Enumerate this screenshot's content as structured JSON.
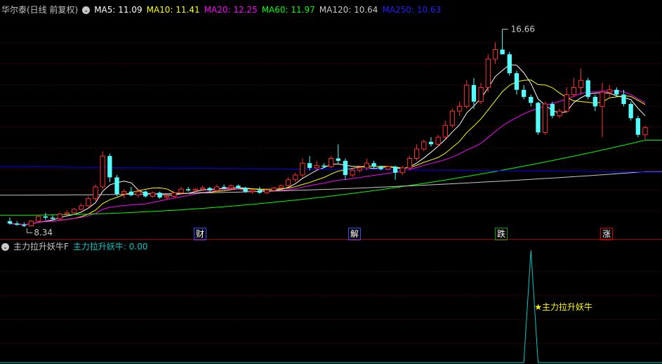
{
  "main_legend": {
    "title": "华尔泰(日线 前复权)",
    "items": [
      {
        "label": "MA5: 11.09",
        "color": "#ffffff"
      },
      {
        "label": "MA10: 11.41",
        "color": "#ffff00"
      },
      {
        "label": "MA20: 12.25",
        "color": "#ff00ff"
      },
      {
        "label": "MA60: 11.97",
        "color": "#00ff00"
      },
      {
        "label": "MA120: 10.64",
        "color": "#c8c8c8"
      },
      {
        "label": "MA250: 10.63",
        "color": "#0000ff"
      }
    ]
  },
  "sub_legend": {
    "title": "主力拉升妖牛F",
    "value_label": "主力拉升妖牛: 0.00",
    "value_color": "#00c8c8"
  },
  "markers": [
    {
      "label": "财",
      "color": "#3050ff"
    },
    {
      "label": "解",
      "color": "#3050ff"
    },
    {
      "label": "跌",
      "color": "#00a000"
    },
    {
      "label": "涨",
      "color": "#d00000"
    }
  ],
  "colors": {
    "up": "#ff3030",
    "down": "#54ffff",
    "grid": "#800000",
    "signal": "#00c8c8",
    "annotation": "#ffff00"
  },
  "chart_data": {
    "type": "candlestick",
    "ylim": [
      7.8,
      17.3
    ],
    "ohlc": [
      [
        8.55,
        8.7,
        8.4,
        8.45
      ],
      [
        8.45,
        8.55,
        8.35,
        8.4
      ],
      [
        8.4,
        8.5,
        8.3,
        8.35
      ],
      [
        8.35,
        8.6,
        8.34,
        8.55
      ],
      [
        8.55,
        8.8,
        8.5,
        8.75
      ],
      [
        8.75,
        8.9,
        8.6,
        8.7
      ],
      [
        8.7,
        8.8,
        8.6,
        8.65
      ],
      [
        8.65,
        8.9,
        8.6,
        8.85
      ],
      [
        8.85,
        9.0,
        8.8,
        8.9
      ],
      [
        8.9,
        9.1,
        8.85,
        9.05
      ],
      [
        9.05,
        9.3,
        9.0,
        9.2
      ],
      [
        9.2,
        9.6,
        9.15,
        9.5
      ],
      [
        9.5,
        10.1,
        9.4,
        10.0
      ],
      [
        10.0,
        11.5,
        9.9,
        11.3
      ],
      [
        11.3,
        11.4,
        10.2,
        10.4
      ],
      [
        10.4,
        10.5,
        9.6,
        9.7
      ],
      [
        9.7,
        9.9,
        9.5,
        9.8
      ],
      [
        9.8,
        10.0,
        9.6,
        9.65
      ],
      [
        9.65,
        9.9,
        9.55,
        9.8
      ],
      [
        9.8,
        9.85,
        9.55,
        9.6
      ],
      [
        9.6,
        9.8,
        9.55,
        9.75
      ],
      [
        9.75,
        9.8,
        9.5,
        9.55
      ],
      [
        9.55,
        9.7,
        9.45,
        9.6
      ],
      [
        9.6,
        9.8,
        9.55,
        9.75
      ],
      [
        9.75,
        10.0,
        9.7,
        9.9
      ],
      [
        9.9,
        10.0,
        9.8,
        9.85
      ],
      [
        9.85,
        9.95,
        9.8,
        9.9
      ],
      [
        9.9,
        10.05,
        9.85,
        9.95
      ],
      [
        9.95,
        10.0,
        9.8,
        9.85
      ],
      [
        9.85,
        10.1,
        9.8,
        10.0
      ],
      [
        10.0,
        10.1,
        9.9,
        9.95
      ],
      [
        9.95,
        10.1,
        9.9,
        10.05
      ],
      [
        10.05,
        10.1,
        9.9,
        9.95
      ],
      [
        9.95,
        10.0,
        9.75,
        9.8
      ],
      [
        9.8,
        9.9,
        9.7,
        9.85
      ],
      [
        9.85,
        10.0,
        9.7,
        9.75
      ],
      [
        9.75,
        9.9,
        9.7,
        9.85
      ],
      [
        9.85,
        10.0,
        9.8,
        9.95
      ],
      [
        9.95,
        10.1,
        9.9,
        10.05
      ],
      [
        10.05,
        10.4,
        10.0,
        10.3
      ],
      [
        10.3,
        10.6,
        10.2,
        10.5
      ],
      [
        10.5,
        11.2,
        10.4,
        11.0
      ],
      [
        11.0,
        11.3,
        10.7,
        10.8
      ],
      [
        10.8,
        11.1,
        10.7,
        10.9
      ],
      [
        10.9,
        11.0,
        10.8,
        10.85
      ],
      [
        10.85,
        11.3,
        10.8,
        11.2
      ],
      [
        11.2,
        11.8,
        11.0,
        11.1
      ],
      [
        11.1,
        11.2,
        10.3,
        10.5
      ],
      [
        10.5,
        10.8,
        10.4,
        10.7
      ],
      [
        10.7,
        10.9,
        10.6,
        10.8
      ],
      [
        10.8,
        11.2,
        10.7,
        11.0
      ],
      [
        11.0,
        11.1,
        10.8,
        10.85
      ],
      [
        10.85,
        10.9,
        10.7,
        10.75
      ],
      [
        10.75,
        10.9,
        10.7,
        10.85
      ],
      [
        10.85,
        10.9,
        10.3,
        10.6
      ],
      [
        10.6,
        10.9,
        10.5,
        10.8
      ],
      [
        10.8,
        11.3,
        10.7,
        11.2
      ],
      [
        11.2,
        11.8,
        11.1,
        11.6
      ],
      [
        11.6,
        12.0,
        11.5,
        11.9
      ],
      [
        11.9,
        12.1,
        11.7,
        11.8
      ],
      [
        11.8,
        12.2,
        11.7,
        12.1
      ],
      [
        12.1,
        12.8,
        12.0,
        12.6
      ],
      [
        12.6,
        13.3,
        12.5,
        13.2
      ],
      [
        13.2,
        13.6,
        13.0,
        13.4
      ],
      [
        13.4,
        14.5,
        13.3,
        14.3
      ],
      [
        14.3,
        14.6,
        13.3,
        13.6
      ],
      [
        13.6,
        14.4,
        13.5,
        14.2
      ],
      [
        14.2,
        15.6,
        14.0,
        15.4
      ],
      [
        15.4,
        16.1,
        15.2,
        15.8
      ],
      [
        15.8,
        16.66,
        15.6,
        15.6
      ],
      [
        15.6,
        15.7,
        14.7,
        14.8
      ],
      [
        14.8,
        14.9,
        13.9,
        14.1
      ],
      [
        14.1,
        14.3,
        13.7,
        13.8
      ],
      [
        13.8,
        13.9,
        13.4,
        13.55
      ],
      [
        13.55,
        13.6,
        12.2,
        12.3
      ],
      [
        12.3,
        13.6,
        12.2,
        13.5
      ],
      [
        13.5,
        13.6,
        12.9,
        13.0
      ],
      [
        13.0,
        13.3,
        12.9,
        13.2
      ],
      [
        13.2,
        14.2,
        13.1,
        13.9
      ],
      [
        13.9,
        14.6,
        13.8,
        14.2
      ],
      [
        14.2,
        15.0,
        13.9,
        14.5
      ],
      [
        14.5,
        14.6,
        13.7,
        13.8
      ],
      [
        13.8,
        13.9,
        13.2,
        13.4
      ],
      [
        13.4,
        14.4,
        12.1,
        14.0
      ],
      [
        14.0,
        14.3,
        13.8,
        14.1
      ],
      [
        14.1,
        14.2,
        13.8,
        13.9
      ],
      [
        13.9,
        14.1,
        13.4,
        13.5
      ],
      [
        13.5,
        13.6,
        12.8,
        12.9
      ],
      [
        12.9,
        13.0,
        12.1,
        12.2
      ],
      [
        12.2,
        12.6,
        12.0,
        12.5
      ]
    ],
    "signal": {
      "ylim": [
        0,
        1
      ],
      "peak_index": 73,
      "peak_value": 1,
      "label": "★主力拉升妖牛"
    },
    "annotations": [
      {
        "index": 69,
        "label": "16.66",
        "kind": "high"
      },
      {
        "index": 2,
        "label": "8.34",
        "kind": "low"
      }
    ],
    "ma_series": [
      {
        "name": "MA5",
        "color": "#ffffff",
        "period": 5
      },
      {
        "name": "MA10",
        "color": "#ffff00",
        "period": 10
      },
      {
        "name": "MA20",
        "color": "#ff00ff",
        "period": 20
      },
      {
        "name": "MA60",
        "color": "#00ff00",
        "start": 8.8,
        "end": 11.97
      },
      {
        "name": "MA120",
        "color": "#c8c8c8",
        "start": 9.65,
        "end": 10.64
      },
      {
        "name": "MA250",
        "color": "#0000ff",
        "start": 10.85,
        "end": 10.63
      }
    ]
  }
}
